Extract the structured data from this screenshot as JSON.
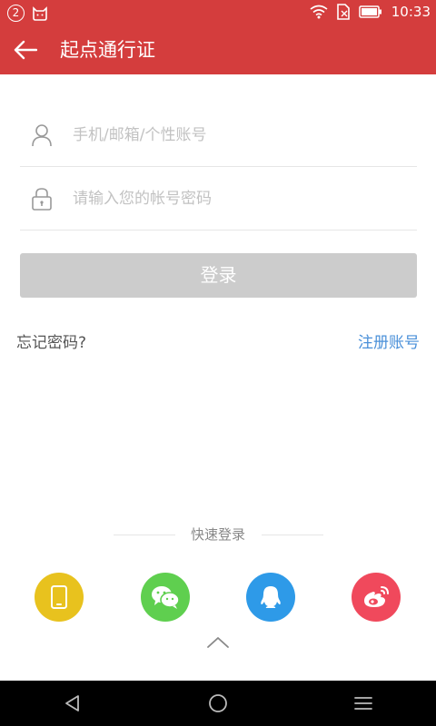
{
  "status_bar": {
    "notification_count": "2",
    "time": "10:33"
  },
  "app_bar": {
    "title": "起点通行证"
  },
  "login_form": {
    "account_placeholder": "手机/邮箱/个性账号",
    "password_placeholder": "请输入您的帐号密码",
    "login_label": "登录",
    "forgot_label": "忘记密码?",
    "register_label": "注册账号"
  },
  "quick_login": {
    "title": "快速登录",
    "providers": [
      {
        "name": "phone-icon",
        "color": "#e8c21e"
      },
      {
        "name": "wechat-icon",
        "color": "#5fcf4f"
      },
      {
        "name": "qq-icon",
        "color": "#2e9ae8"
      },
      {
        "name": "weibo-icon",
        "color": "#f0495c"
      }
    ]
  },
  "colors": {
    "brand": "#d43d3d",
    "link": "#4a90d9",
    "button_disabled": "#cccccc"
  }
}
